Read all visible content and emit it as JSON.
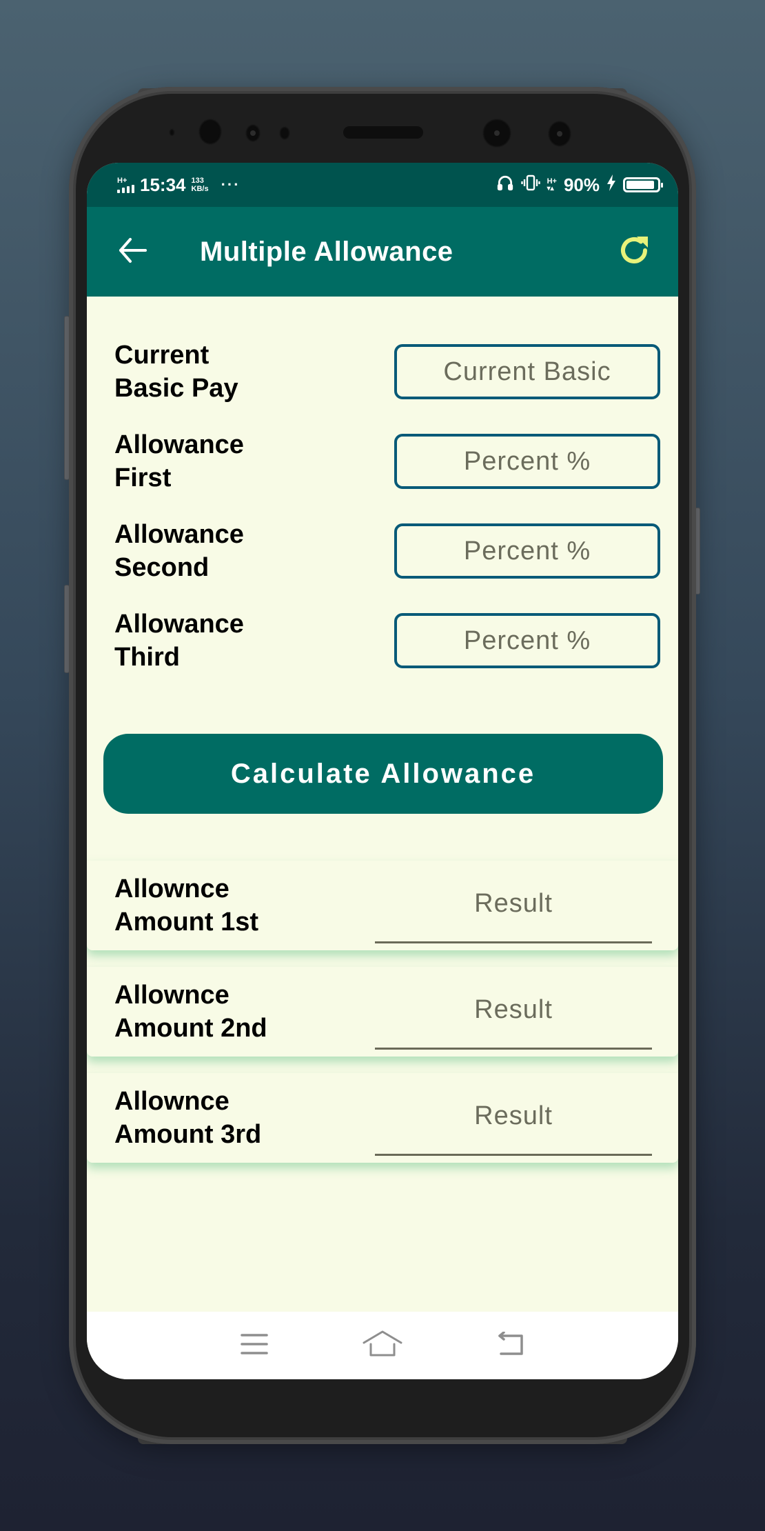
{
  "status_bar": {
    "network_type": "H+",
    "time": "15:34",
    "data_speed_value": "133",
    "data_speed_unit": "KB/s",
    "more_indicator": "···",
    "mobile_data_type": "H+",
    "battery_percent": "90%",
    "battery_level": 0.9,
    "charging": true,
    "icons": [
      "signal-icon",
      "headphones-icon",
      "vibrate-icon",
      "mobile-data-icon",
      "charging-icon",
      "battery-icon"
    ]
  },
  "app_bar": {
    "title": "Multiple Allowance",
    "back_icon": "arrow-left-icon",
    "refresh_icon": "refresh-icon",
    "accent_color": "#006c63",
    "refresh_color": "#e8f27a"
  },
  "form": {
    "fields": [
      {
        "label": "Current\nBasic Pay",
        "placeholder": "Current Basic",
        "value": ""
      },
      {
        "label": "Allowance\nFirst",
        "placeholder": "Percent %",
        "value": ""
      },
      {
        "label": "Allowance\nSecond",
        "placeholder": "Percent %",
        "value": ""
      },
      {
        "label": "Allowance\nThird",
        "placeholder": "Percent %",
        "value": ""
      }
    ],
    "border_color": "#085a78"
  },
  "calculate_button": {
    "label": "Calculate Allowance"
  },
  "results": [
    {
      "label": "Allownce\nAmount 1st",
      "placeholder": "Result"
    },
    {
      "label": "Allownce\nAmount 2nd",
      "placeholder": "Result"
    },
    {
      "label": "Allownce\nAmount 3rd",
      "placeholder": "Result"
    }
  ],
  "nav_bar": {
    "buttons": [
      "menu-icon",
      "home-icon",
      "back-icon"
    ]
  }
}
